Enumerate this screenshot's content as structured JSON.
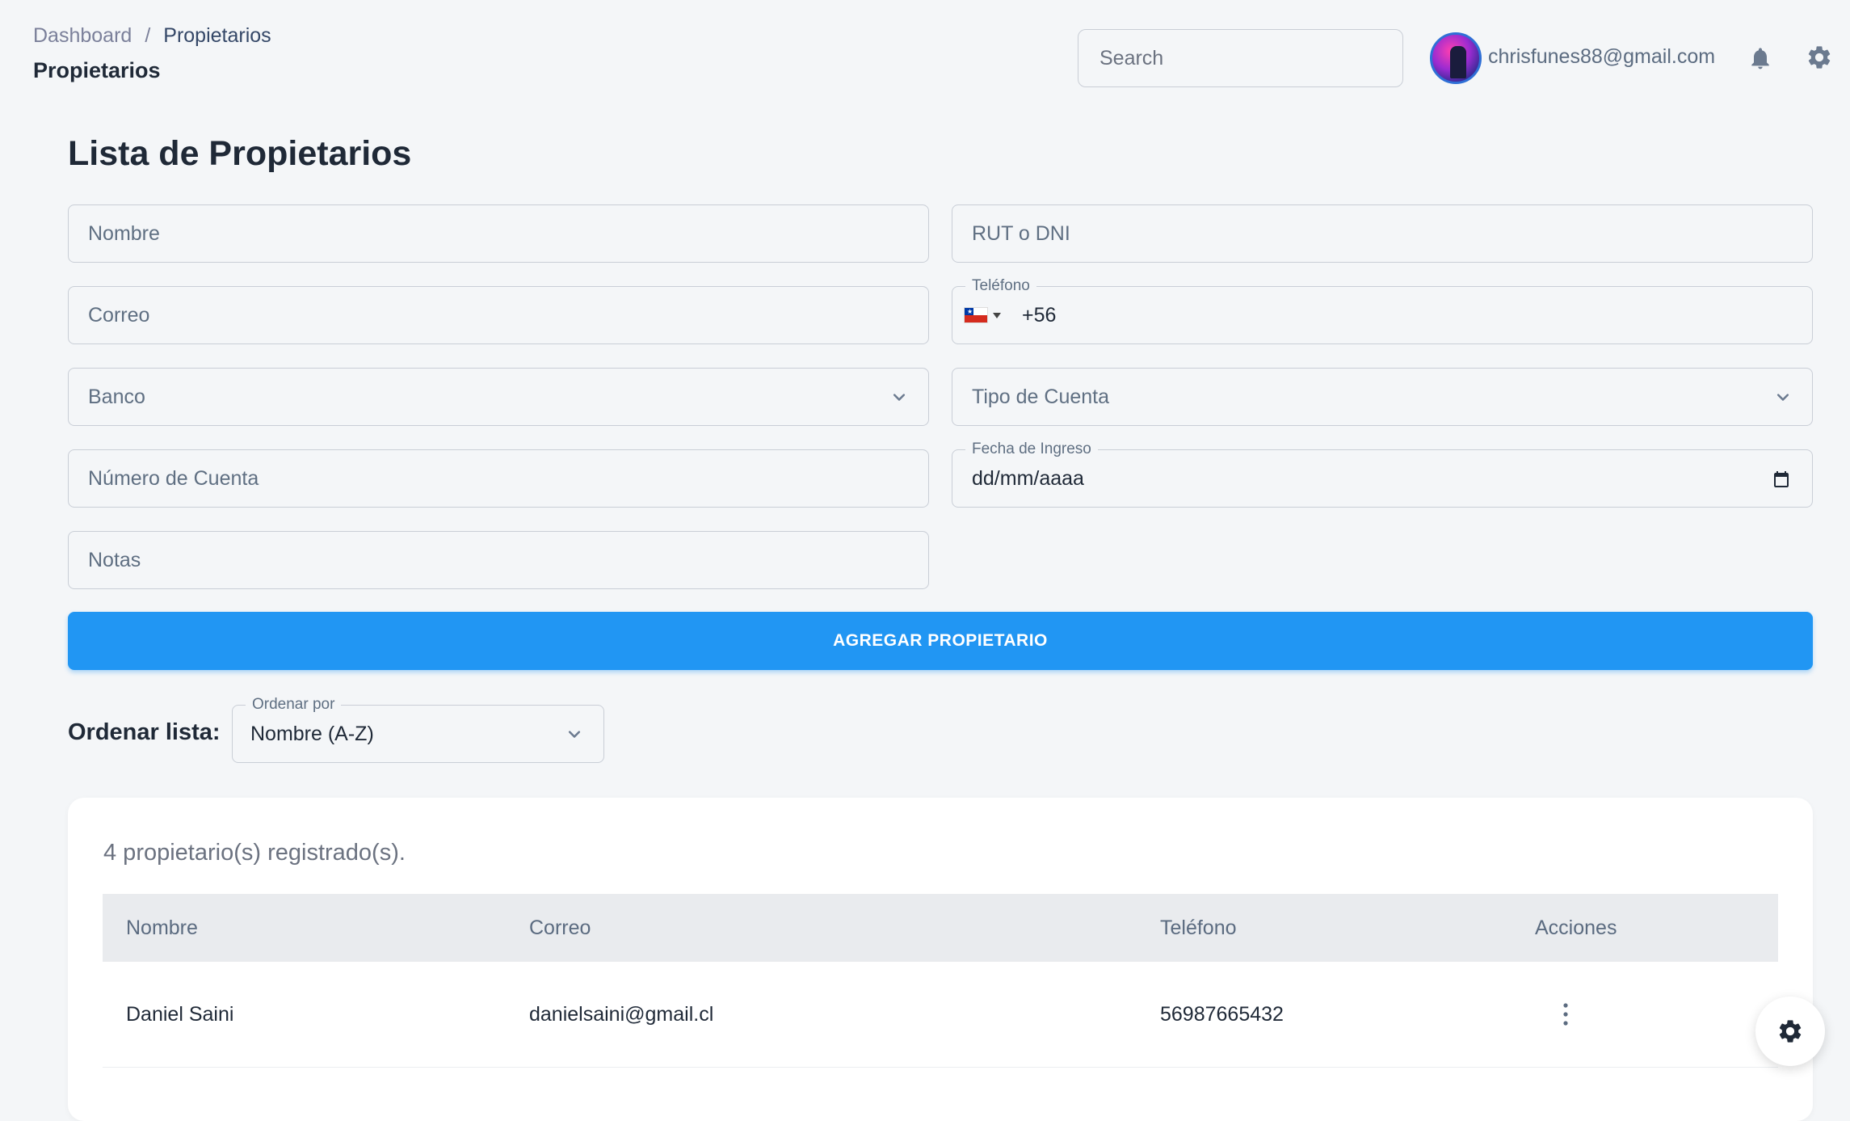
{
  "breadcrumb": {
    "root": "Dashboard",
    "separator": "/",
    "current": "Propietarios"
  },
  "header": {
    "title": "Propietarios",
    "search_placeholder": "Search",
    "user_email": "chrisfunes88@gmail.com",
    "icons": [
      "bell-icon",
      "gear-icon"
    ]
  },
  "form": {
    "title": "Lista de Propietarios",
    "nombre_placeholder": "Nombre",
    "rut_placeholder": "RUT o DNI",
    "correo_placeholder": "Correo",
    "telefono_label": "Teléfono",
    "telefono_value": "+56",
    "telefono_country": "CL",
    "banco_placeholder": "Banco",
    "tipo_cuenta_placeholder": "Tipo de Cuenta",
    "numero_cuenta_placeholder": "Número de Cuenta",
    "fecha_label": "Fecha de Ingreso",
    "fecha_value": "dd/mm/aaaa",
    "notas_placeholder": "Notas",
    "submit_label": "AGREGAR PROPIETARIO"
  },
  "sort": {
    "label": "Ordenar lista:",
    "select_label": "Ordenar por",
    "selected": "Nombre (A-Z)"
  },
  "table": {
    "count_text": "4 propietario(s) registrado(s).",
    "columns": [
      "Nombre",
      "Correo",
      "Teléfono",
      "Acciones"
    ],
    "rows": [
      {
        "nombre": "Daniel Saini",
        "correo": "danielsaini@gmail.cl",
        "telefono": "56987665432"
      }
    ]
  },
  "colors": {
    "primary": "#2196f3",
    "background": "#f4f6f8",
    "text_dark": "#1f2937"
  }
}
